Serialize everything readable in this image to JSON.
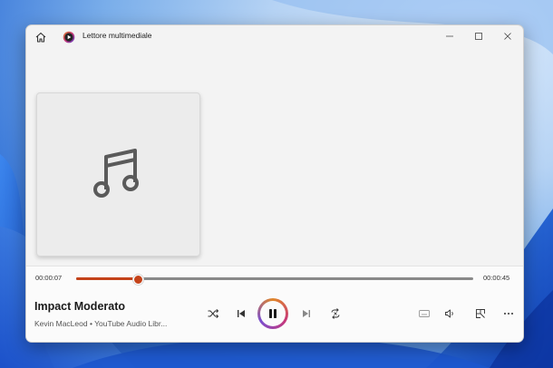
{
  "window": {
    "title": "Lettore multimediale",
    "icons": {
      "home": "home-icon",
      "app": "media-player-icon",
      "minimize": "minimize-icon",
      "maximize": "maximize-icon",
      "close": "close-icon"
    }
  },
  "album_art": {
    "icon": "music-note-icon"
  },
  "playback": {
    "elapsed": "00:00:07",
    "total": "00:00:45",
    "progress_fraction": 0.155,
    "accent_color": "#c4431a"
  },
  "track": {
    "title": "Impact Moderato",
    "artist": "Kevin MacLeod • YouTube Audio Libr..."
  },
  "controls": {
    "icons": [
      "shuffle-icon",
      "previous-icon",
      "pause-icon",
      "next-icon",
      "repeat-icon",
      "miniplayer-icon",
      "volume-icon",
      "cast-icon",
      "more-icon"
    ]
  }
}
